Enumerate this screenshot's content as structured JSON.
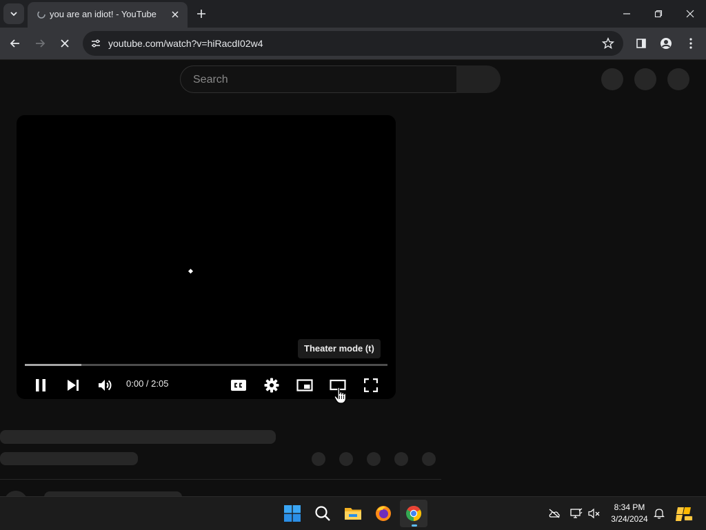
{
  "browser": {
    "tab": {
      "title": "you are an idiot! - YouTube"
    },
    "omnibox": {
      "url": "youtube.com/watch?v=hiRacdI02w4"
    }
  },
  "youtube": {
    "search": {
      "placeholder": "Search"
    },
    "player": {
      "tooltip": "Theater mode (t)",
      "time": "0:00 / 2:05",
      "progress_loaded_fraction": 0.155,
      "controls": [
        "pause",
        "next",
        "volume",
        "captions",
        "settings",
        "miniplayer",
        "theater",
        "fullscreen"
      ]
    }
  },
  "taskbar": {
    "apps": [
      "windows-start",
      "search",
      "file-explorer",
      "firefox",
      "chrome"
    ],
    "active_app": "chrome",
    "clock": {
      "time": "8:34 PM",
      "date": "3/24/2024"
    }
  },
  "colors": {
    "page_background": "#0f0f0f",
    "skeleton": "#272727",
    "chrome_toolbar": "#35363a",
    "taskbar": "#1c1c1c",
    "active_indicator": "#5ebfff"
  }
}
